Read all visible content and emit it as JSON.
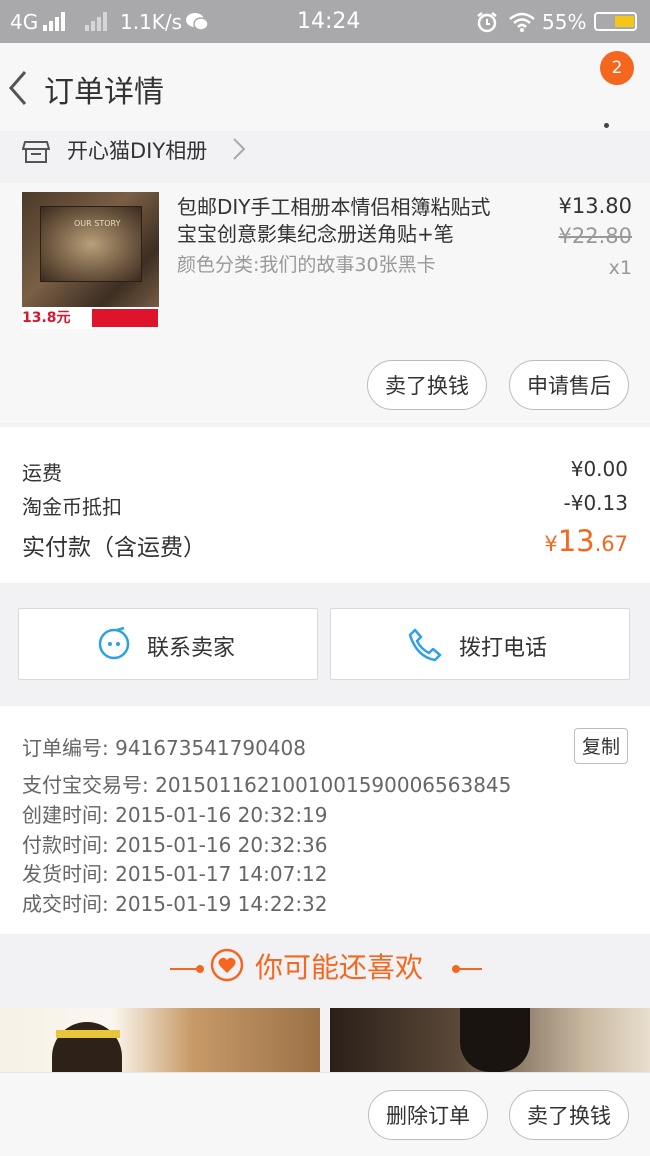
{
  "status_bar": {
    "network": "4G",
    "speed": "1.1K/s",
    "time": "14:24",
    "battery": "55%"
  },
  "header": {
    "title": "订单详情",
    "badge_count": "2"
  },
  "shop": {
    "name": "开心猫DIY相册"
  },
  "product": {
    "title": "包邮DIY手工相册本情侣相簿粘贴式宝宝创意影集纪念册送角贴+笔",
    "sku": "颜色分类:我们的故事30张黑卡",
    "price": "¥13.80",
    "original_price": "¥22.80",
    "quantity": "x1",
    "thumb_price_text": "13.8元",
    "thumb_album_text": "OUR STORY"
  },
  "product_actions": {
    "sell_label": "卖了换钱",
    "after_sale_label": "申请售后"
  },
  "fees": {
    "shipping_label": "运费",
    "shipping_value": "¥0.00",
    "coin_label": "淘金币抵扣",
    "coin_value": "-¥0.13",
    "total_label": "实付款（含运费）",
    "total_currency": "¥",
    "total_int": "13",
    "total_dec": ".67"
  },
  "contact": {
    "seller_label": "联系卖家",
    "phone_label": "拨打电话"
  },
  "order_info": {
    "order_no": "订单编号: 941673541790408",
    "copy_label": "复制",
    "alipay_no": "支付宝交易号: 2015011621001001590006563845",
    "created": "创建时间: 2015-01-16 20:32:19",
    "paid": "付款时间: 2015-01-16 20:32:36",
    "shipped": "发货时间: 2015-01-17 14:07:12",
    "completed": "成交时间: 2015-01-19 14:22:32"
  },
  "recommend": {
    "title": "你可能还喜欢"
  },
  "bottom_bar": {
    "delete_label": "删除订单",
    "sell_label": "卖了换钱"
  },
  "colors": {
    "accent": "#f5661f",
    "contact_icon": "#2fa0e6"
  }
}
